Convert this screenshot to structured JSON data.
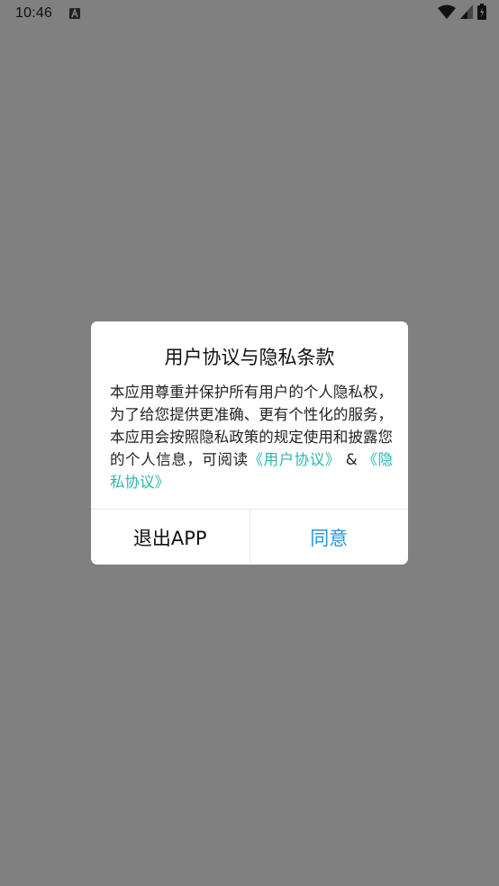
{
  "status_bar": {
    "time": "10:46"
  },
  "dialog": {
    "title": "用户协议与隐私条款",
    "body_text": "本应用尊重并保护所有用户的个人隐私权，为了给您提供更准确、更有个性化的服务，本应用会按照隐私政策的规定使用和披露您的个人信息，可阅读",
    "link_user_agreement": "《用户协议》",
    "ampersand": " & ",
    "link_privacy": "《隐私协议》",
    "exit_button": "退出APP",
    "agree_button": "同意"
  },
  "colors": {
    "overlay": "#808080",
    "link": "#2db7b0",
    "agree": "#2a95d8"
  },
  "icons": [
    "android-notification-icon",
    "wifi-icon",
    "signal-icon",
    "battery-icon"
  ]
}
